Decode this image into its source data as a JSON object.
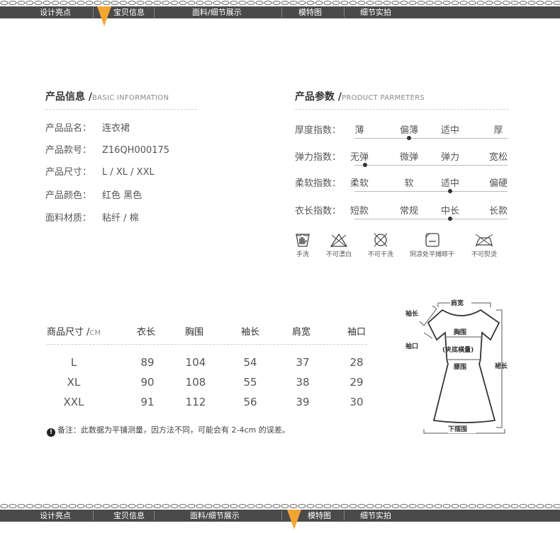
{
  "nav": {
    "items": [
      "设计亮点",
      "宝贝信息",
      "面料/细节展示",
      "模特图",
      "细节实拍"
    ],
    "top_active": "宝贝信息",
    "bottom_active": "模特图"
  },
  "product_info": {
    "title": "产品信息 /",
    "title_en": "BASIC INFORMATION",
    "rows": [
      {
        "label": "产品品名：",
        "value": "连衣裙"
      },
      {
        "label": "产品款号：",
        "value": "Z16QH000175"
      },
      {
        "label": "产品尺寸：",
        "value": "L / XL / XXL"
      },
      {
        "label": "产品颜色：",
        "value": "红色 黑色"
      },
      {
        "label": "面料材质：",
        "value": "粘纤 / 棉"
      }
    ]
  },
  "product_params": {
    "title": "产品参数 /",
    "title_en": "PRODUCT PARMETERS",
    "rows": [
      {
        "label": "厚度指数：",
        "options": [
          "薄",
          "偏薄",
          "适中",
          "厚"
        ],
        "selected": 1
      },
      {
        "label": "弹力指数：",
        "options": [
          "无弹",
          "微弹",
          "弹力",
          "宽松"
        ],
        "selected": 0
      },
      {
        "label": "柔软指数：",
        "options": [
          "柔软",
          "软",
          "适中",
          "偏硬"
        ],
        "selected": 2
      },
      {
        "label": "衣长指数：",
        "options": [
          "短款",
          "常规",
          "中长",
          "长款"
        ],
        "selected": 2
      }
    ]
  },
  "care": {
    "items": [
      {
        "label": "手洗",
        "icon": "hand-wash-icon"
      },
      {
        "label": "不可漂白",
        "icon": "no-bleach-icon"
      },
      {
        "label": "不可干洗",
        "icon": "no-dry-clean-icon"
      },
      {
        "label": "阴凉处平摊晾干",
        "icon": "dry-flat-shade-icon"
      },
      {
        "label": "不可熨烫",
        "icon": "no-iron-icon"
      }
    ]
  },
  "size_table": {
    "header": {
      "first": "商品尺寸 /",
      "unit": "CM",
      "cols": [
        "衣长",
        "胸围",
        "袖长",
        "肩宽",
        "袖口"
      ]
    },
    "rows": [
      {
        "size": "L",
        "values": [
          "89",
          "104",
          "54",
          "37",
          "28"
        ]
      },
      {
        "size": "XL",
        "values": [
          "90",
          "108",
          "55",
          "38",
          "29"
        ]
      },
      {
        "size": "XXL",
        "values": [
          "91",
          "112",
          "56",
          "39",
          "30"
        ]
      }
    ],
    "note": "备注：此数据为平铺测量，因方法不同，可能会有 2-4cm 的误差。"
  },
  "diagram": {
    "shoulder": "肩宽",
    "sleeve_length": "袖长",
    "cuff": "袖口",
    "chest": "胸围",
    "chest_note": "(夹底横量)",
    "waist": "腰围",
    "skirt_length": "裙长",
    "hem": "下摆围"
  }
}
